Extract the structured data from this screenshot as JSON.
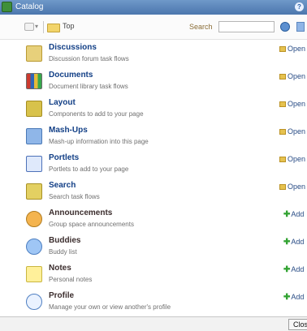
{
  "window": {
    "title": "Catalog"
  },
  "toolbar": {
    "top_label": "Top",
    "search_label": "Search",
    "search_value": "",
    "search_placeholder": ""
  },
  "items": [
    {
      "name": "Discussions",
      "description": "Discussion forum task flows",
      "action": "Open",
      "action_type": "open",
      "icon": "discussions-icon"
    },
    {
      "name": "Documents",
      "description": "Document library task flows",
      "action": "Open",
      "action_type": "open",
      "icon": "documents-icon"
    },
    {
      "name": "Layout",
      "description": "Components to add to your page",
      "action": "Open",
      "action_type": "open",
      "icon": "layout-icon"
    },
    {
      "name": "Mash-Ups",
      "description": "Mash-up information into this page",
      "action": "Open",
      "action_type": "open",
      "icon": "mashups-icon"
    },
    {
      "name": "Portlets",
      "description": "Portlets to add to your page",
      "action": "Open",
      "action_type": "open",
      "icon": "portlets-icon"
    },
    {
      "name": "Search",
      "description": "Search task flows",
      "action": "Open",
      "action_type": "open",
      "icon": "search-icon"
    },
    {
      "name": "Announcements",
      "description": "Group space announcements",
      "action": "Add",
      "action_type": "add",
      "icon": "announcements-icon"
    },
    {
      "name": "Buddies",
      "description": "Buddy list",
      "action": "Add",
      "action_type": "add",
      "icon": "buddies-icon"
    },
    {
      "name": "Notes",
      "description": "Personal notes",
      "action": "Add",
      "action_type": "add",
      "icon": "notes-icon"
    },
    {
      "name": "Profile",
      "description": "Manage your own or view another's profile",
      "action": "Add",
      "action_type": "add",
      "icon": "profile-icon"
    }
  ],
  "footer": {
    "close_label": "Clos"
  }
}
